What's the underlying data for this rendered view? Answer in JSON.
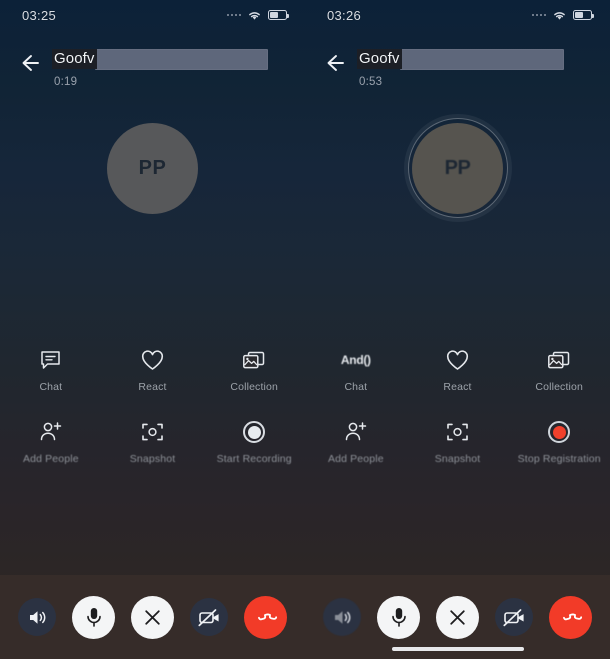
{
  "screen": {
    "type": "video-call-comparison",
    "background_top_color": "#0c2138",
    "background_bottom_color": "#2e2725",
    "bottom_bar_color": "#362c29",
    "accent_red": "#f23b28",
    "redaction_color": "#5e677b"
  },
  "panels": [
    {
      "id": "left",
      "statusbar": {
        "clock": "03:25",
        "signal_icon": "signal-dots-icon",
        "wifi_icon": "wifi-icon",
        "battery_icon": "battery-icon"
      },
      "header": {
        "back_icon": "back-arrow-icon",
        "peer_name": "Goofv",
        "redacted": true,
        "call_timer": "0:19"
      },
      "avatar": {
        "initials": "PP",
        "speaking_ring": false,
        "garbled": false
      },
      "actions_row1": [
        {
          "label": "Chat",
          "icon": "chat-bubble-icon",
          "garbled": false
        },
        {
          "label": "React",
          "icon": "heart-icon",
          "garbled": false
        },
        {
          "label": "Collection",
          "icon": "photo-stack-icon",
          "garbled": false
        }
      ],
      "actions_row2": [
        {
          "label": "Add People",
          "icon": "add-person-icon",
          "garbled": false
        },
        {
          "label": "Snapshot",
          "icon": "snapshot-frame-icon",
          "garbled": false
        },
        {
          "label": "Start Recording",
          "icon": "record-dot-icon",
          "recording": false
        }
      ],
      "controls": [
        {
          "name": "speaker",
          "icon": "speaker-icon",
          "style": "dark"
        },
        {
          "name": "microphone",
          "icon": "microphone-icon",
          "style": "white"
        },
        {
          "name": "close",
          "icon": "close-x-icon",
          "style": "white"
        },
        {
          "name": "camera-off",
          "icon": "camera-off-icon",
          "style": "dark"
        },
        {
          "name": "hang-up",
          "icon": "hang-up-icon",
          "style": "red"
        }
      ],
      "home_indicator": false
    },
    {
      "id": "right",
      "statusbar": {
        "clock": "03:26",
        "signal_icon": "signal-dots-icon",
        "wifi_icon": "wifi-icon",
        "battery_icon": "battery-icon"
      },
      "header": {
        "back_icon": "back-arrow-icon",
        "peer_name": "Goofv",
        "redacted": true,
        "call_timer": "0:53"
      },
      "avatar": {
        "initials": "PP",
        "speaking_ring": true,
        "garbled": true
      },
      "actions_row1": [
        {
          "label": "Chat",
          "icon": "chat-bubble-icon",
          "badge": "And()",
          "garbled": true
        },
        {
          "label": "React",
          "icon": "heart-icon",
          "garbled": false
        },
        {
          "label": "Collection",
          "icon": "photo-stack-icon",
          "garbled": false
        }
      ],
      "actions_row2": [
        {
          "label": "Add People",
          "icon": "add-person-icon",
          "garbled": false
        },
        {
          "label": "Snapshot",
          "icon": "snapshot-frame-icon",
          "garbled": false
        },
        {
          "label": "Stop Registration",
          "icon": "record-dot-icon",
          "recording": true
        }
      ],
      "controls": [
        {
          "name": "speaker",
          "icon": "speaker-icon",
          "style": "dark",
          "glitch": true
        },
        {
          "name": "microphone",
          "icon": "microphone-icon",
          "style": "white"
        },
        {
          "name": "close",
          "icon": "close-x-icon",
          "style": "white"
        },
        {
          "name": "camera-off",
          "icon": "camera-off-icon",
          "style": "dark"
        },
        {
          "name": "hang-up",
          "icon": "hang-up-icon",
          "style": "red"
        }
      ],
      "home_indicator": true
    }
  ]
}
